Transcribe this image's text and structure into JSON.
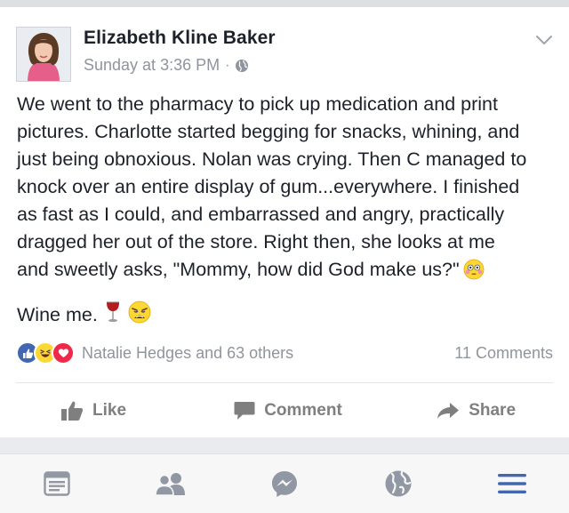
{
  "post": {
    "author": "Elizabeth Kline Baker",
    "timestamp": "Sunday at 3:36 PM",
    "separator": "·",
    "privacy_icon": "globe-icon",
    "body_lines": [
      "We went to the pharmacy to pick up medication and print",
      "pictures. Charlotte started begging for snacks, whining, and",
      "just being obnoxious. Nolan was crying. Then C managed to",
      "knock over an entire display of gum...everywhere. I finished",
      "as fast as I could, and embarrassed and angry, practically",
      "dragged her out of the store. Right then, she looks at me",
      "and sweetly asks, \"Mommy, how did God make us?\""
    ],
    "body_end_emoji": "flushed-face-emoji",
    "closing_text": "Wine me.",
    "closing_emojis": [
      "wine-glass-emoji",
      "weary-face-emoji"
    ]
  },
  "reactions": {
    "icons": [
      "like-reaction-icon",
      "haha-reaction-icon",
      "love-reaction-icon"
    ],
    "names": "Natalie Hedges and 63 others",
    "comments": "11 Comments"
  },
  "actions": {
    "like": "Like",
    "comment": "Comment",
    "share": "Share"
  },
  "tabbar": {
    "items": [
      "news-feed-icon",
      "friends-icon",
      "messenger-icon",
      "notifications-globe-icon",
      "menu-icon"
    ],
    "active_color": "#4267b2",
    "inactive_color": "#9197a3"
  },
  "colors": {
    "brand_blue": "#4267b2",
    "meta_gray": "#90949c",
    "action_gray": "#7f7f7f"
  }
}
